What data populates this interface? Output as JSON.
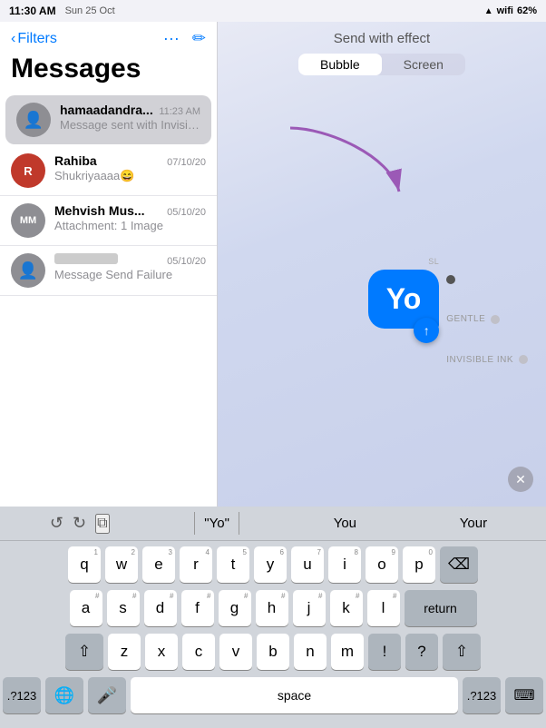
{
  "statusBar": {
    "time": "11:30 AM",
    "date": "Sun 25 Oct",
    "battery": "62%",
    "signal": "●●●"
  },
  "sidebar": {
    "filtersLabel": "Filters",
    "title": "Messages",
    "conversations": [
      {
        "id": "hamaadandra",
        "initials": "",
        "avatarType": "gray",
        "name": "hamaadandra...",
        "time": "11:23 AM",
        "preview": "Message sent with Invisible Ink",
        "active": true
      },
      {
        "id": "rahiba",
        "initials": "R",
        "avatarType": "red",
        "name": "Rahiba",
        "time": "07/10/20",
        "preview": "Shukriyaaaa😄",
        "active": false
      },
      {
        "id": "mehvish",
        "initials": "MM",
        "avatarType": "mm",
        "name": "Mehvish Mus...",
        "time": "05/10/20",
        "preview": "Attachment: 1 Image",
        "active": false
      },
      {
        "id": "unknown",
        "initials": "",
        "avatarType": "gray",
        "name": "blurred",
        "time": "05/10/20",
        "preview": "Message Send Failure",
        "active": false
      }
    ]
  },
  "effectPanel": {
    "title": "Send with effect",
    "tabs": [
      "Bubble",
      "Screen"
    ],
    "activeTab": "Bubble",
    "options": [
      {
        "label": "",
        "active": true
      },
      {
        "label": "GENTLE",
        "active": false
      },
      {
        "label": "INVISIBLE INK",
        "active": false
      }
    ]
  },
  "messageBubble": {
    "text": "Yo",
    "sendLabel": "SL"
  },
  "keyboard": {
    "autocorrect": [
      {
        "label": "\"Yo\"",
        "quoted": true
      },
      {
        "label": "You",
        "quoted": false
      },
      {
        "label": "Your",
        "quoted": false
      }
    ],
    "rows": [
      [
        "q",
        "w",
        "e",
        "r",
        "t",
        "y",
        "u",
        "i",
        "o",
        "p"
      ],
      [
        "a",
        "s",
        "d",
        "f",
        "g",
        "h",
        "j",
        "k",
        "l"
      ],
      [
        "z",
        "x",
        "c",
        "v",
        "b",
        "n",
        "m"
      ]
    ],
    "returnLabel": "return",
    "spaceLabel": "space",
    "sym123Label": ".?123",
    "deleteIcon": "⌫",
    "shiftIcon": "⇧",
    "globeIcon": "🌐",
    "micIcon": "🎤",
    "keyboardIcon": "⌨"
  }
}
